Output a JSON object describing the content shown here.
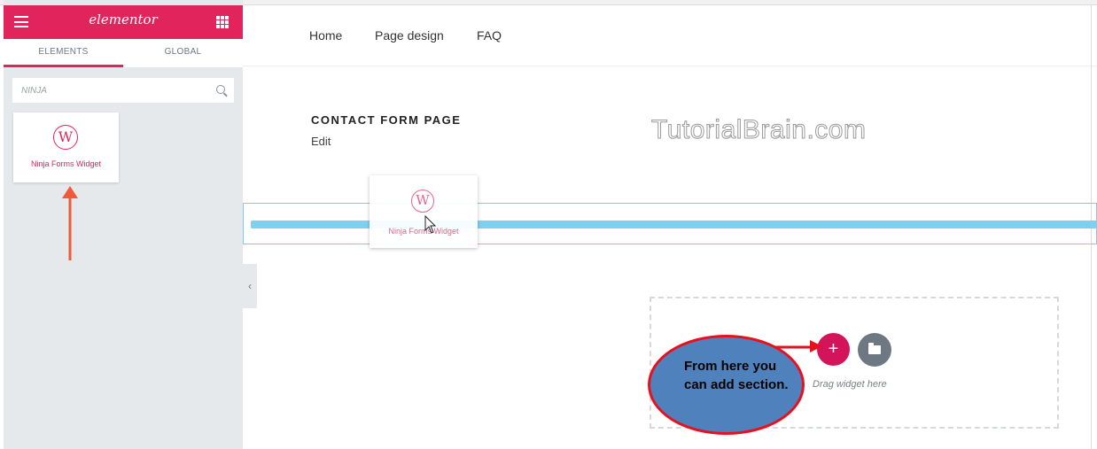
{
  "editor": {
    "logo": "elementor",
    "tabs": [
      "ELEMENTS",
      "GLOBAL"
    ],
    "search_value": "NINJA",
    "widget_label": "Ninja Forms Widget",
    "accent_color": "#e2245c"
  },
  "site": {
    "nav": [
      "Home",
      "Page design",
      "FAQ"
    ],
    "page_title": "CONTACT FORM PAGE",
    "edit_label": "Edit",
    "watermark": "TutorialBrain.com"
  },
  "drag": {
    "ghost_label": "Ninja Forms Widget"
  },
  "add_section": {
    "hint": "Drag widget here",
    "add_symbol": "+"
  },
  "callout": {
    "text": "From here you can add section.",
    "fill_color": "#4f81bd",
    "border_color": "#e8101e"
  }
}
